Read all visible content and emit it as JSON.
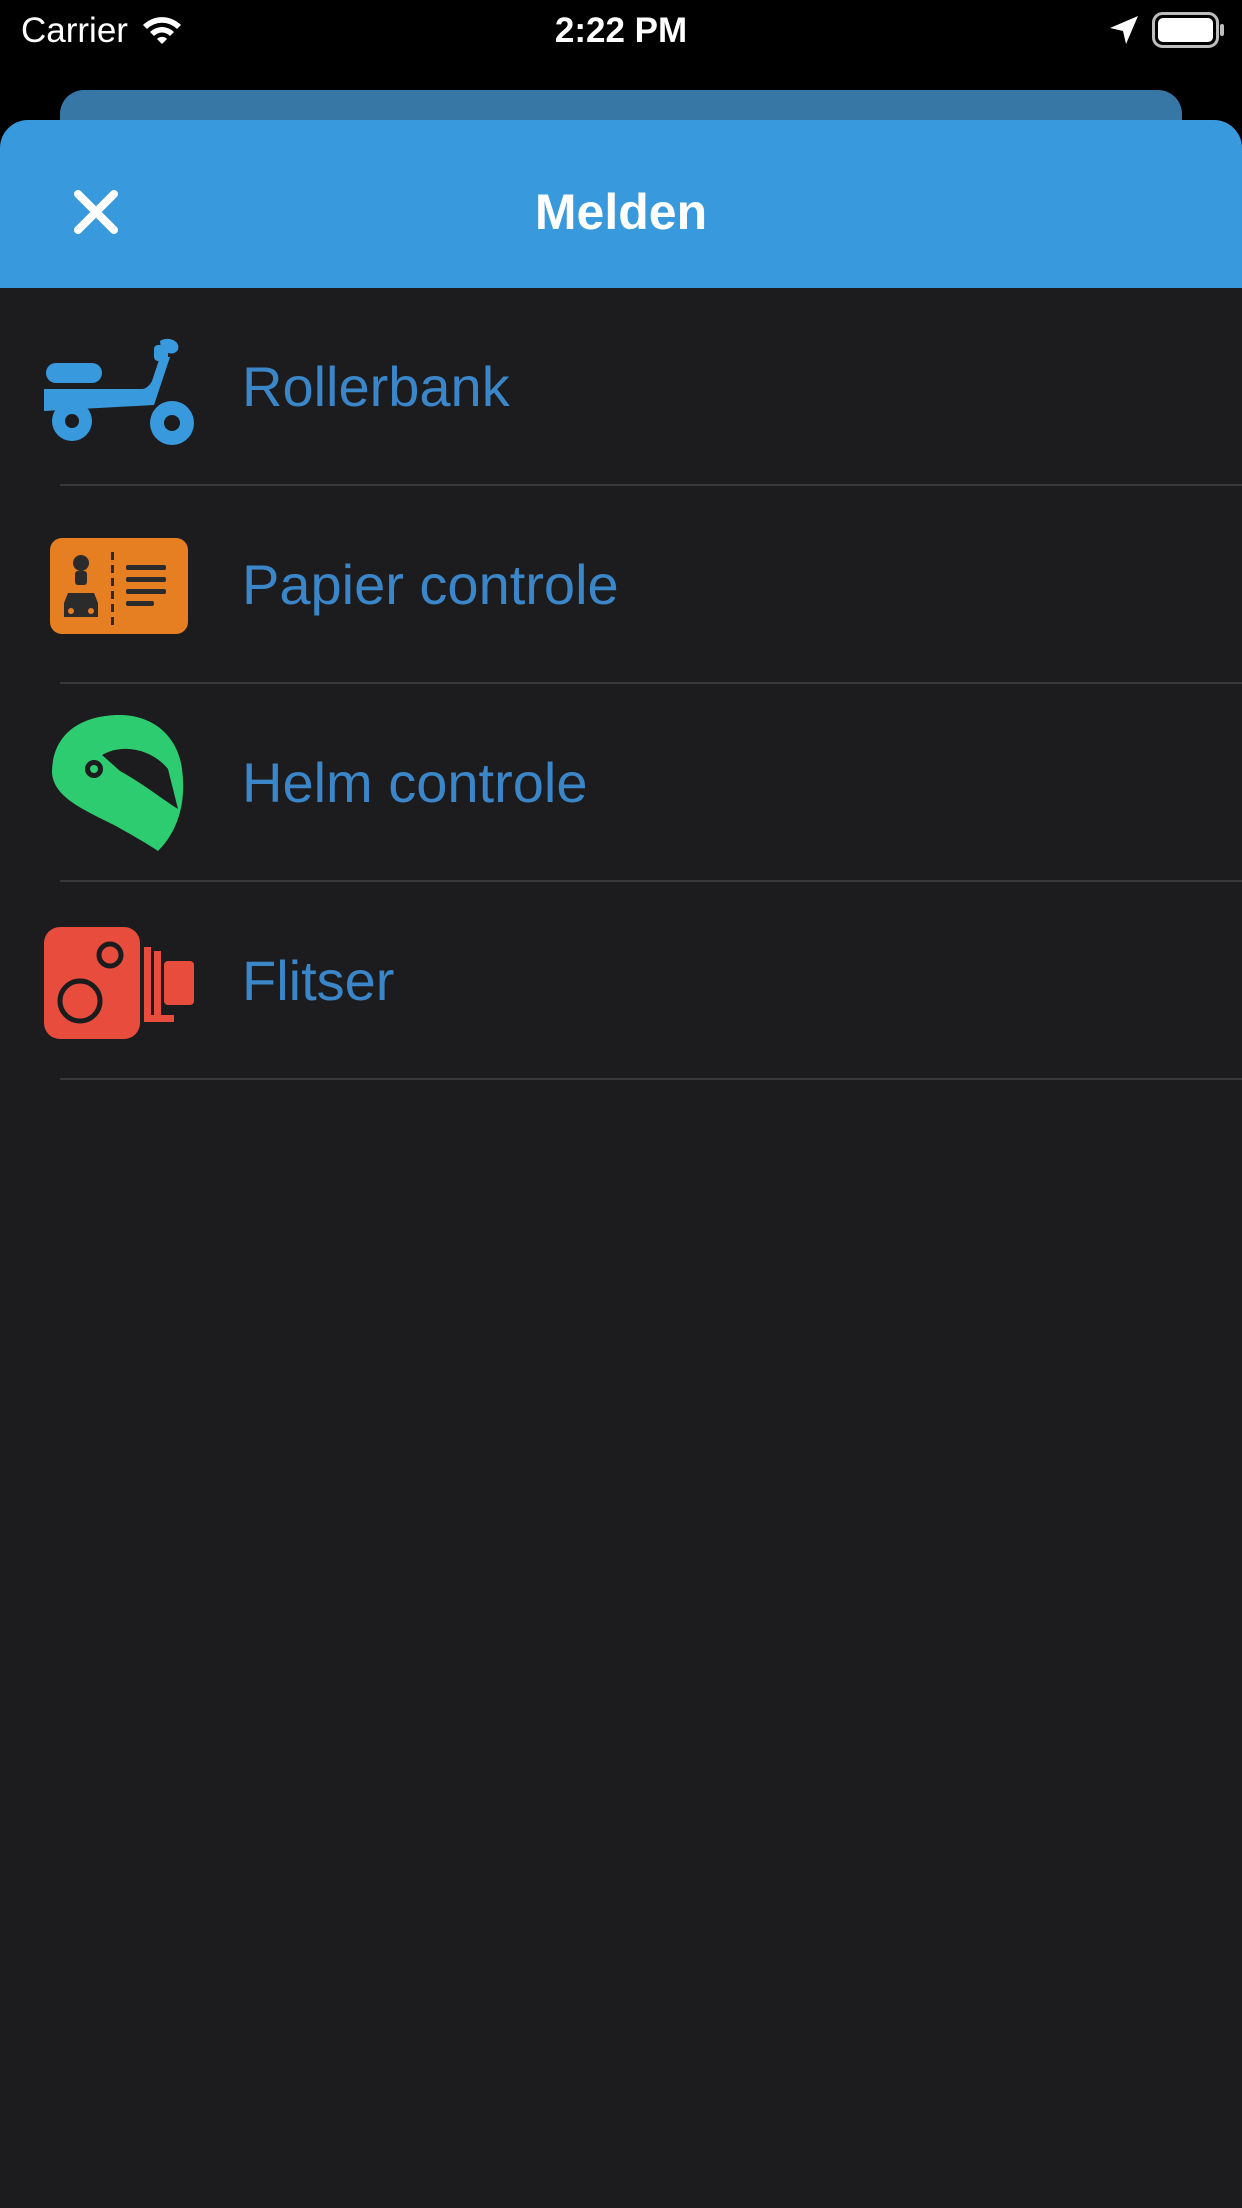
{
  "status_bar": {
    "carrier": "Carrier",
    "time": "2:22 PM",
    "wifi_icon": "wifi-icon",
    "location_icon": "location-arrow-icon",
    "battery_icon": "battery-icon"
  },
  "header": {
    "title": "Melden",
    "close_icon": "close-icon",
    "background": "#3899dc"
  },
  "menu": {
    "items": [
      {
        "label": "Rollerbank",
        "icon": "scooter-icon",
        "icon_color": "#3899dc"
      },
      {
        "label": "Papier controle",
        "icon": "license-card-icon",
        "icon_color": "#e67e22"
      },
      {
        "label": "Helm controle",
        "icon": "helmet-icon",
        "icon_color": "#2ecc71"
      },
      {
        "label": "Flitser",
        "icon": "speed-camera-icon",
        "icon_color": "#e74c3c"
      }
    ],
    "label_color": "#3a86c8"
  },
  "theme": {
    "background": "#1c1c1e",
    "separator": "#38383a"
  }
}
